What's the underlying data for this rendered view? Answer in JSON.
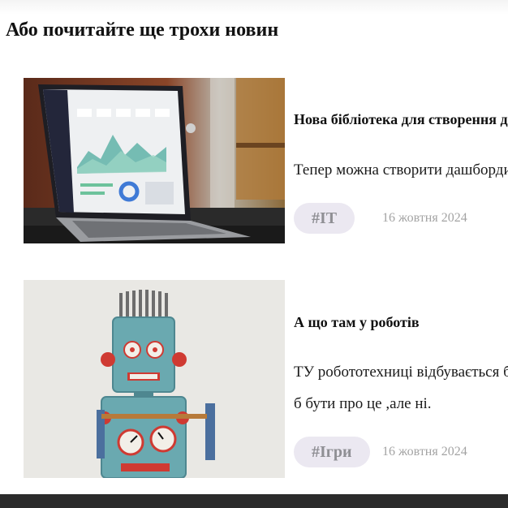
{
  "section": {
    "title": "Або почитайте ще трохи новин"
  },
  "news": [
    {
      "image": "laptop-dashboard-photo",
      "title": "Нова бібліотека для створення дашбордів",
      "text": "Тепер можна створити дашборди швидше",
      "tag": "#IT",
      "date": "16 жовтня 2024"
    },
    {
      "image": "toy-robot-photo",
      "title": "А що там у роботів",
      "text_lines": [
        "ТУ робототехниці відбувається багато чого, мало",
        "б бути про це ,але ні."
      ],
      "tag": "#Ігри",
      "date": "16 жовтня 2024"
    }
  ],
  "colors": {
    "tag_bg": "#ebe8f1",
    "tag_text": "#8f8f94",
    "date_text": "#a3a3a3",
    "footer": "#2b2b2b"
  }
}
